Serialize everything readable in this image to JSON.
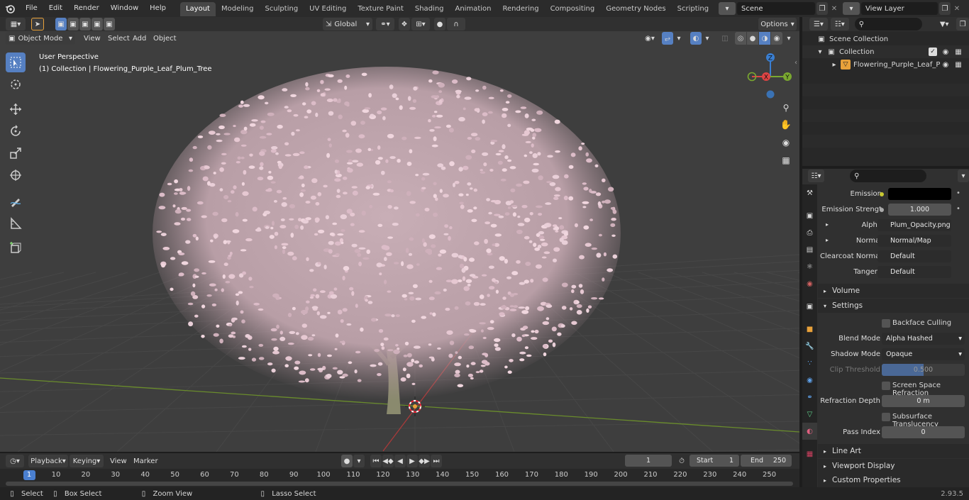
{
  "topbar": {
    "menus": [
      "File",
      "Edit",
      "Render",
      "Window",
      "Help"
    ],
    "workspaces": [
      "Layout",
      "Modeling",
      "Sculpting",
      "UV Editing",
      "Texture Paint",
      "Shading",
      "Animation",
      "Rendering",
      "Compositing",
      "Geometry Nodes",
      "Scripting"
    ],
    "active_workspace": "Layout",
    "scene": "Scene",
    "view_layer": "View Layer"
  },
  "viewport": {
    "mode": "Object Mode",
    "menus": [
      "View",
      "Select",
      "Add",
      "Object"
    ],
    "orientation": "Global",
    "options_label": "Options",
    "overlay_title": "User Perspective",
    "overlay_subtitle": "(1) Collection | Flowering_Purple_Leaf_Plum_Tree",
    "gizmo": {
      "x": "X",
      "y": "Y",
      "z": "Z"
    },
    "accent_selected": "#5680c2",
    "blossom_color": "#e6c8d2"
  },
  "outliner": {
    "root": "Scene Collection",
    "collection": "Collection",
    "object": "Flowering_Purple_Leaf_P"
  },
  "properties": {
    "rows": [
      {
        "label": "Emission",
        "value": "",
        "kind": "color"
      },
      {
        "label": "Emission Strengt",
        "value": "1.000",
        "kind": "number"
      },
      {
        "label": "Alpha",
        "value": "Plum_Opacity.png",
        "kind": "link"
      },
      {
        "label": "Normal",
        "value": "Normal/Map",
        "kind": "link"
      },
      {
        "label": "Clearcoat Normal",
        "value": "Default",
        "kind": "link"
      },
      {
        "label": "Tangent",
        "value": "Default",
        "kind": "link"
      }
    ],
    "panel_volume": "Volume",
    "panel_settings": "Settings",
    "backface_culling": "Backface Culling",
    "blend_mode_label": "Blend Mode",
    "blend_mode": "Alpha Hashed",
    "shadow_mode_label": "Shadow Mode",
    "shadow_mode": "Opaque",
    "clip_threshold_label": "Clip Threshold",
    "clip_threshold": "0.500",
    "screen_space_refraction": "Screen Space Refraction",
    "refraction_depth_label": "Refraction Depth",
    "refraction_depth": "0 m",
    "subsurface_translucency": "Subsurface Translucency",
    "pass_index_label": "Pass Index",
    "pass_index": "0",
    "panel_line_art": "Line Art",
    "panel_viewport_display": "Viewport Display",
    "panel_custom_properties": "Custom Properties"
  },
  "timeline": {
    "menus": [
      "Playback",
      "Keying",
      "View",
      "Marker"
    ],
    "current_frame": "1",
    "start_label": "Start",
    "start": "1",
    "end_label": "End",
    "end": "250",
    "ticks": [
      "1",
      "10",
      "20",
      "30",
      "40",
      "50",
      "60",
      "70",
      "80",
      "90",
      "100",
      "110",
      "120",
      "130",
      "140",
      "150",
      "160",
      "170",
      "180",
      "190",
      "200",
      "210",
      "220",
      "230",
      "240",
      "250"
    ]
  },
  "statusbar": {
    "select": "Select",
    "box_select": "Box Select",
    "zoom_view": "Zoom View",
    "lasso_select": "Lasso Select",
    "version": "2.93.5"
  }
}
